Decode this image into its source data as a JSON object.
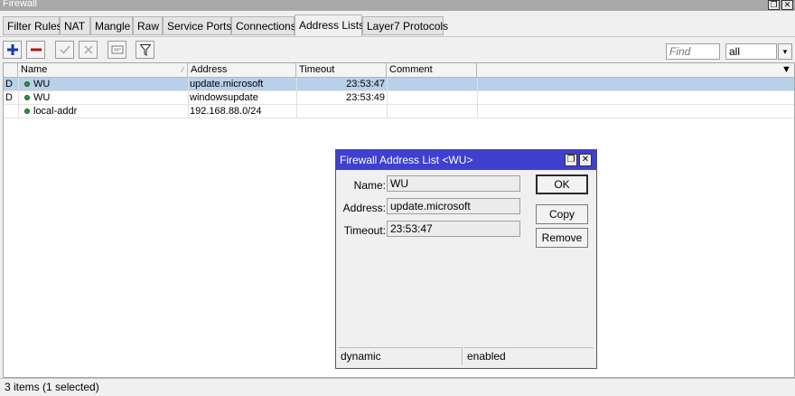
{
  "window": {
    "title": "Firewall",
    "buttons": [
      "❐",
      "✕"
    ]
  },
  "tabs": [
    {
      "label": "Filter Rules"
    },
    {
      "label": "NAT"
    },
    {
      "label": "Mangle"
    },
    {
      "label": "Raw"
    },
    {
      "label": "Service Ports"
    },
    {
      "label": "Connections"
    },
    {
      "label": "Address Lists",
      "active": true
    },
    {
      "label": "Layer7 Protocols"
    }
  ],
  "toolbar": {
    "add_icon": "plus-icon",
    "remove_icon": "minus-icon",
    "enable_icon": "check-icon",
    "disable_icon": "cross-icon",
    "comment_icon": "comment-icon",
    "filter_icon": "filter-icon",
    "find_placeholder": "Find",
    "filter_value": "all"
  },
  "table": {
    "columns": [
      "Name",
      "Address",
      "Timeout",
      "Comment"
    ],
    "rows": [
      {
        "flag": "D",
        "name": "WU",
        "address": "update.microsoft",
        "timeout": "23:53:47",
        "comment": "",
        "selected": true
      },
      {
        "flag": "D",
        "name": "WU",
        "address": "windowsupdate",
        "timeout": "23:53:49",
        "comment": "",
        "selected": false
      },
      {
        "flag": "",
        "name": "local-addr",
        "address": "192.168.88.0/24",
        "timeout": "",
        "comment": "",
        "selected": false
      }
    ]
  },
  "status": {
    "text": "3 items (1 selected)"
  },
  "dialog": {
    "title": "Firewall Address List <WU>",
    "fields": {
      "name_label": "Name:",
      "name_value": "WU",
      "address_label": "Address:",
      "address_value": "update.microsoft",
      "timeout_label": "Timeout:",
      "timeout_value": "23:53:47"
    },
    "buttons": {
      "ok": "OK",
      "copy": "Copy",
      "remove": "Remove"
    },
    "status_left": "dynamic",
    "status_right": "enabled"
  },
  "colors": {
    "dialog_title_bg": "#3f3fd0",
    "selected_row": "#b8d0ea",
    "active_dot": "#2a9a3a"
  }
}
